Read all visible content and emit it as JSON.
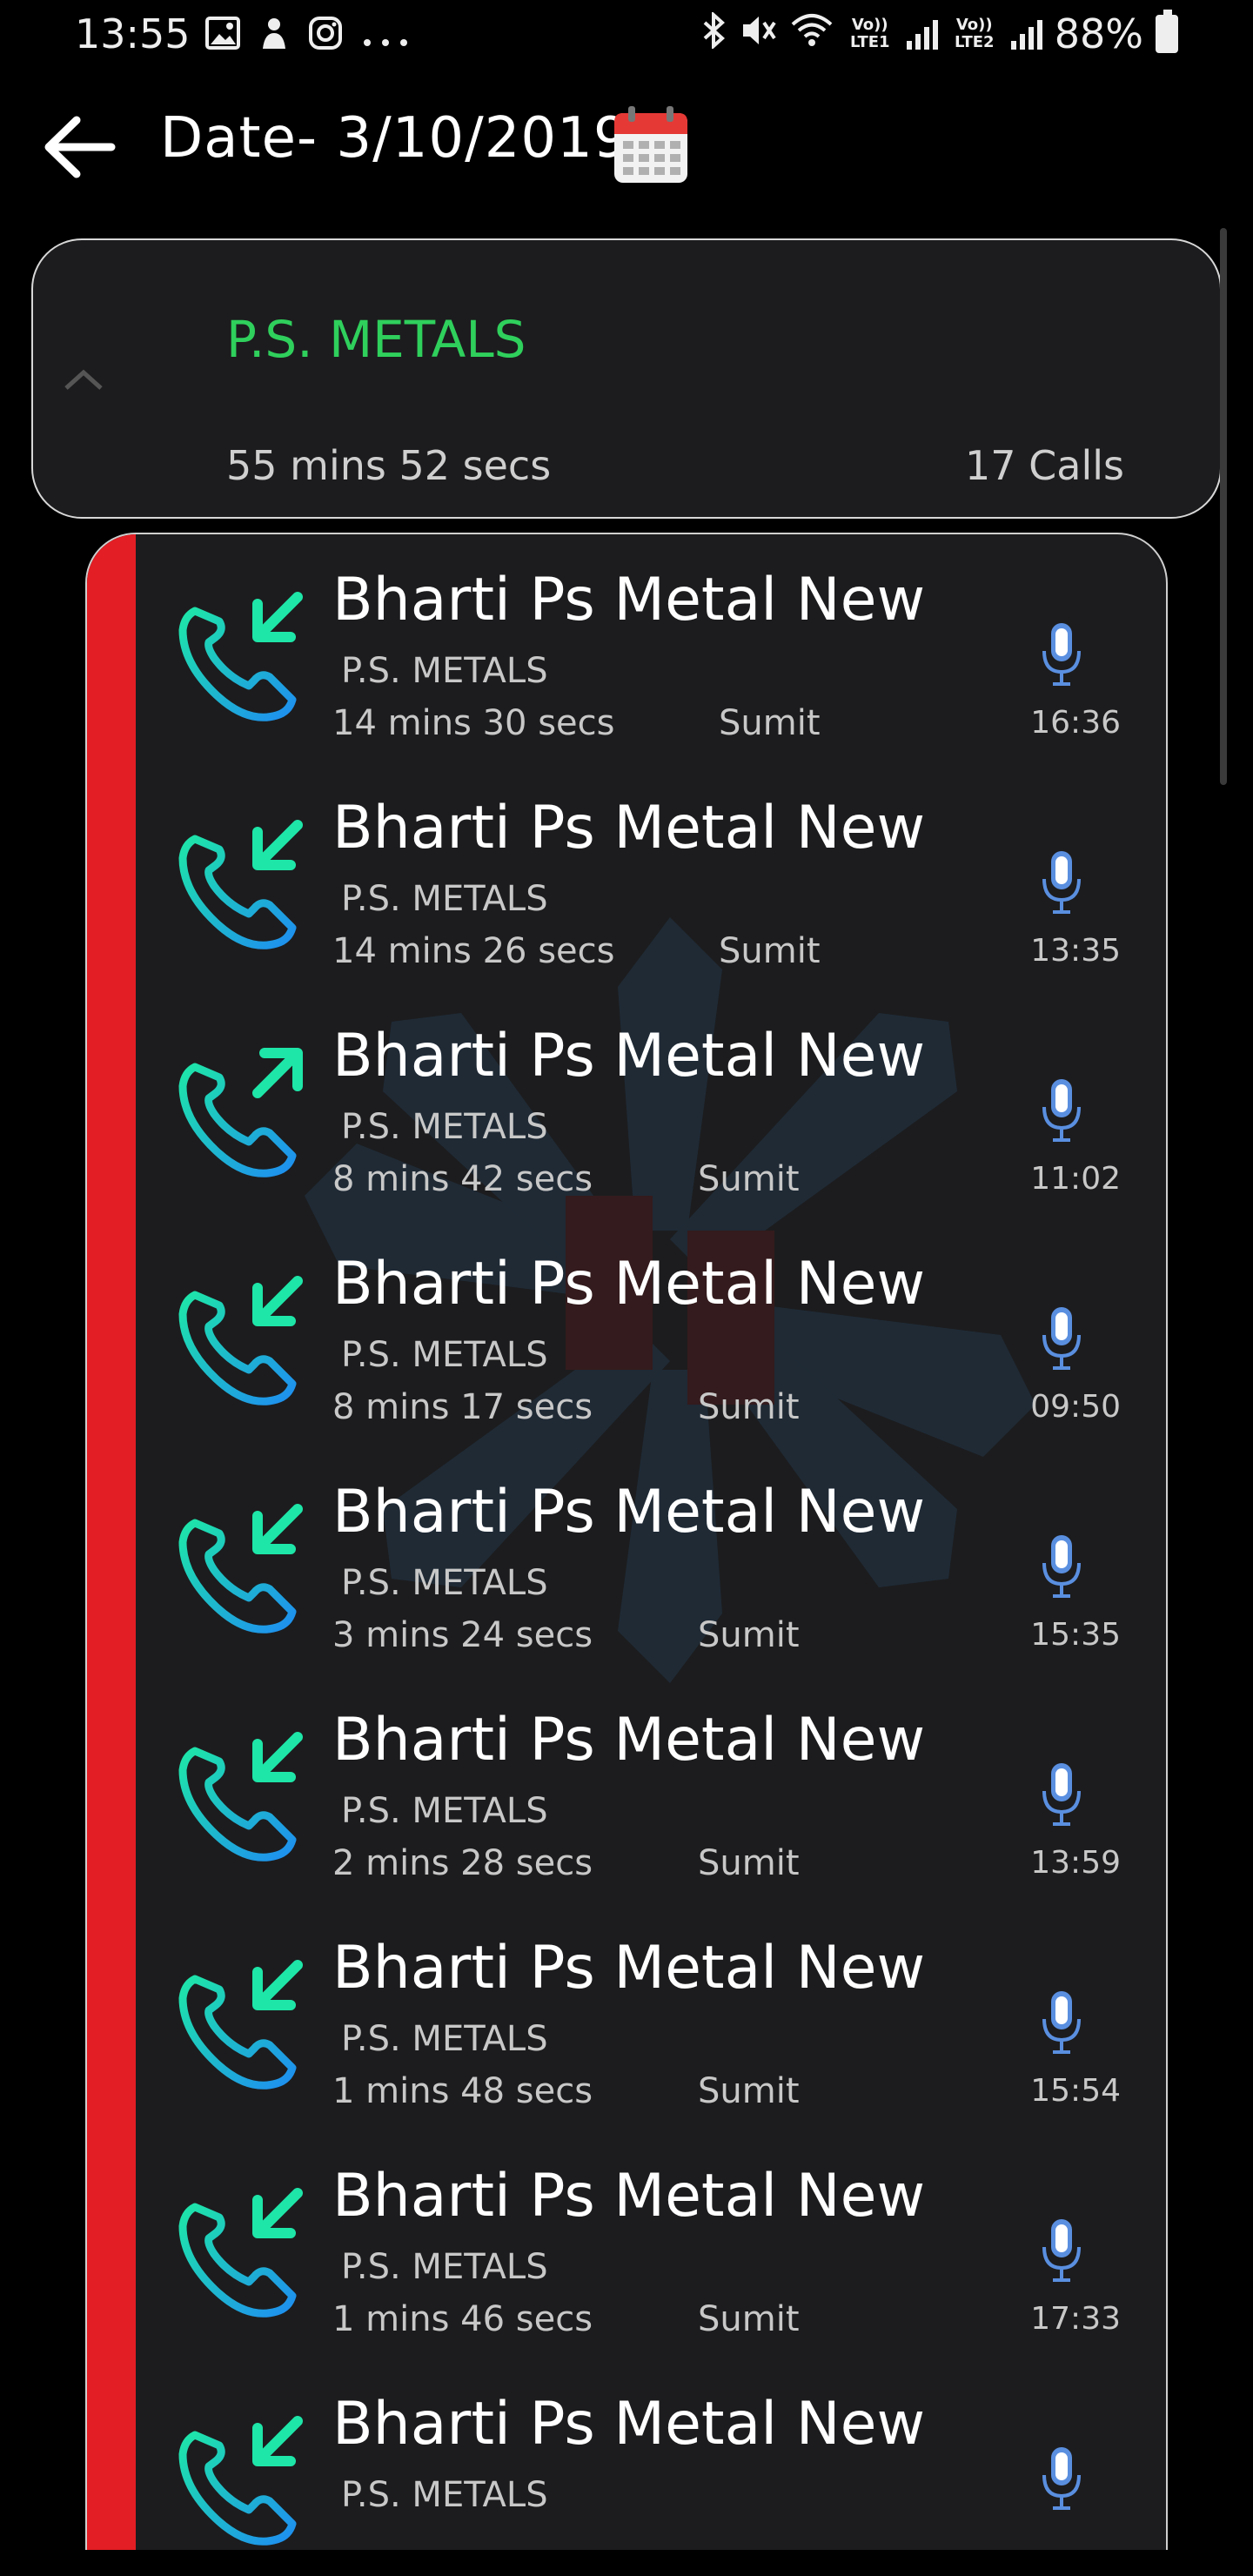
{
  "status_bar": {
    "time": "13:55",
    "battery": "88%",
    "sim1": "Vo)) LTE1",
    "sim2": "Vo)) LTE2",
    "icons_left": [
      "image-icon",
      "notification-icon",
      "instagram-icon",
      "more-icon"
    ],
    "icons_right": [
      "bluetooth-icon",
      "mute-icon",
      "wifi-icon"
    ]
  },
  "app_bar": {
    "title": "Date- 3/10/2019",
    "icon": "calendar-icon"
  },
  "group": {
    "name": "P.S. METALS",
    "duration": "55 mins 52 secs",
    "calls": "17 Calls",
    "name_color": "#2fd05c"
  },
  "calls": [
    {
      "name": "Bharti Ps Metal New",
      "company": "P.S. METALS",
      "duration": "14 mins 30 secs",
      "agent": "Sumit",
      "time": "16:36",
      "direction": "incoming"
    },
    {
      "name": "Bharti Ps Metal New",
      "company": "P.S. METALS",
      "duration": "14 mins 26 secs",
      "agent": "Sumit",
      "time": "13:35",
      "direction": "incoming"
    },
    {
      "name": "Bharti Ps Metal New",
      "company": "P.S. METALS",
      "duration": "8 mins 42 secs",
      "agent": "Sumit",
      "time": "11:02",
      "direction": "outgoing"
    },
    {
      "name": "Bharti Ps Metal New",
      "company": "P.S. METALS",
      "duration": "8 mins 17 secs",
      "agent": "Sumit",
      "time": "09:50",
      "direction": "incoming"
    },
    {
      "name": "Bharti Ps Metal New",
      "company": "P.S. METALS",
      "duration": "3 mins 24 secs",
      "agent": "Sumit",
      "time": "15:35",
      "direction": "incoming"
    },
    {
      "name": "Bharti Ps Metal New",
      "company": "P.S. METALS",
      "duration": "2 mins 28 secs",
      "agent": "Sumit",
      "time": "13:59",
      "direction": "incoming"
    },
    {
      "name": "Bharti Ps Metal New",
      "company": "P.S. METALS",
      "duration": "1 mins 48 secs",
      "agent": "Sumit",
      "time": "15:54",
      "direction": "incoming"
    },
    {
      "name": "Bharti Ps Metal New",
      "company": "P.S. METALS",
      "duration": "1 mins 46 secs",
      "agent": "Sumit",
      "time": "17:33",
      "direction": "incoming"
    },
    {
      "name": "Bharti Ps Metal New",
      "company": "P.S. METALS",
      "duration": "",
      "agent": "",
      "time": "",
      "direction": "incoming"
    }
  ],
  "colors": {
    "accent_red": "#e31e24",
    "call_icon_start": "#1ee6a8",
    "call_icon_end": "#1e8ef0",
    "mic": "#5a8fe0"
  }
}
